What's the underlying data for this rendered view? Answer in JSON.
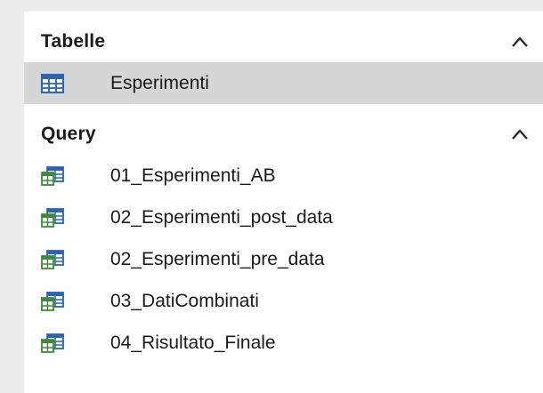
{
  "groups": [
    {
      "title": "Tabelle",
      "collapse_icon": "chevron-up-icon",
      "items": [
        {
          "label": "Esperimenti",
          "icon": "table-icon",
          "selected": true
        }
      ]
    },
    {
      "title": "Query",
      "collapse_icon": "chevron-up-icon",
      "items": [
        {
          "label": "01_Esperimenti_AB",
          "icon": "query-icon"
        },
        {
          "label": "02_Esperimenti_post_data",
          "icon": "query-icon"
        },
        {
          "label": "02_Esperimenti_pre_data",
          "icon": "query-icon"
        },
        {
          "label": "03_DatiCombinati",
          "icon": "query-icon"
        },
        {
          "label": "04_Risultato_Finale",
          "icon": "query-icon"
        }
      ]
    }
  ],
  "colors": {
    "selected_bg": "#d6d6d6",
    "table_icon": "#2b63b5",
    "query_icon_blue": "#2b63b5",
    "query_icon_green": "#3f8a3a"
  }
}
